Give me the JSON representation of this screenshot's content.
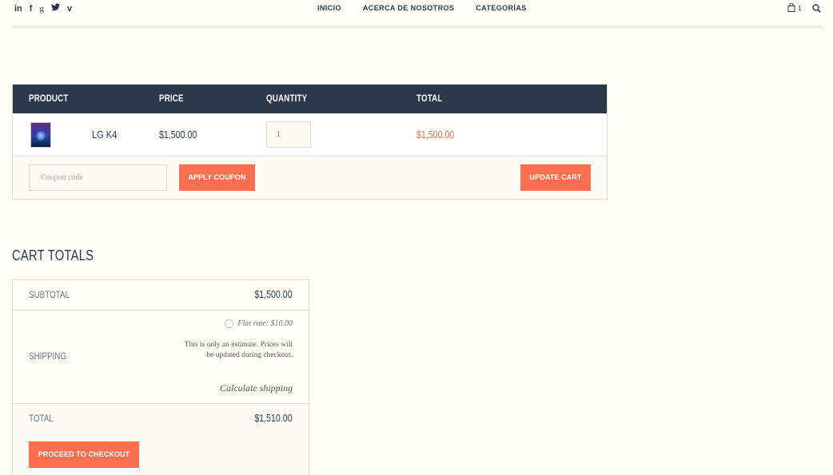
{
  "header": {
    "social": [
      {
        "icon": "linkedin-icon",
        "glyph": "in"
      },
      {
        "icon": "facebook-icon",
        "glyph": "f"
      },
      {
        "icon": "google-plus-icon",
        "glyph": "g"
      },
      {
        "icon": "twitter-icon",
        "glyph": "t"
      },
      {
        "icon": "vimeo-icon",
        "glyph": "v"
      }
    ],
    "nav": [
      "INICIO",
      "ACERCA DE NOSOTROS",
      "CATEGORÍAS"
    ],
    "cart_count": "1"
  },
  "cart": {
    "headers": {
      "product": "PRODUCT",
      "price": "PRICE",
      "quantity": "QUANTITY",
      "total": "TOTAL"
    },
    "item": {
      "name": "LG K4",
      "price": "$1,500.00",
      "quantity": "1",
      "total": "$1,500.00"
    },
    "coupon_placeholder": "Coupon code",
    "apply_label": "APPLY COUPON",
    "update_label": "UPDATE CART"
  },
  "totals": {
    "title": "CART TOTALS",
    "subtotal_label": "SUBTOTAL",
    "subtotal_value": "$1,500.00",
    "shipping_label": "SHIPPING",
    "flat_rate": "Flat rate: $10.00",
    "estimate_note": "This is only an estimate. Prices will be updated during checkout.",
    "calculate_link": "Calculate shipping",
    "total_label": "TOTAL",
    "total_value": "$1,510.00",
    "checkout_label": "PROCEED TO CHECKOUT"
  },
  "colors": {
    "accent": "#fe6f4f",
    "header_dark": "#2a3849",
    "background": "#fffef8"
  }
}
